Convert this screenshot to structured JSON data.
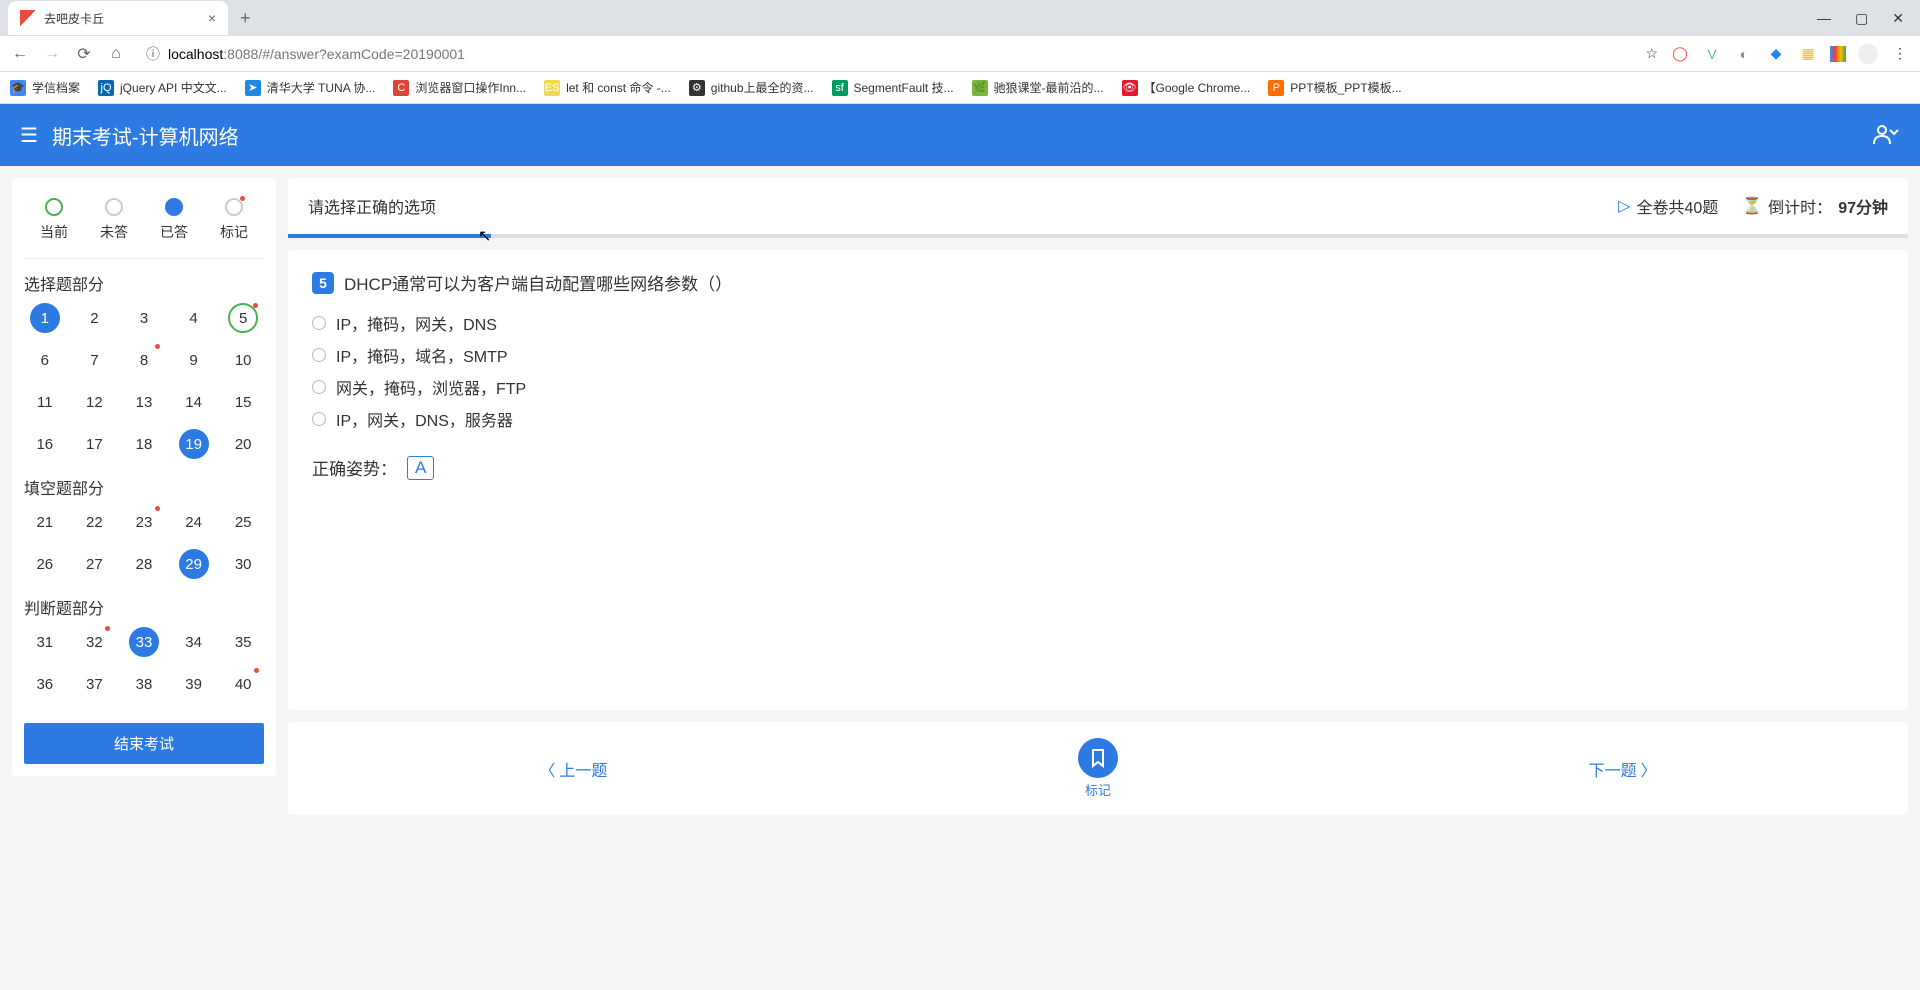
{
  "browser": {
    "tab_title": "去吧皮卡丘",
    "url_protocol": "localhost",
    "url_port": ":8088",
    "url_path": "/#/answer?examCode=20190001"
  },
  "bookmarks": [
    {
      "label": "学信档案",
      "icon": "🎓",
      "color": "#4285f4"
    },
    {
      "label": "jQuery API 中文文...",
      "icon": "jQ",
      "color": "#0769ad"
    },
    {
      "label": "清华大学 TUNA 协...",
      "icon": "➤",
      "color": "#1e88e5"
    },
    {
      "label": "浏览器窗口操作Inn...",
      "icon": "C",
      "color": "#db4437"
    },
    {
      "label": "let 和 const 命令 -...",
      "icon": "ES",
      "color": "#f0db4f"
    },
    {
      "label": "github上最全的资...",
      "icon": "⚙",
      "color": "#333"
    },
    {
      "label": "SegmentFault 技...",
      "icon": "sf",
      "color": "#009a61"
    },
    {
      "label": "驰狼课堂-最前沿的...",
      "icon": "🌿",
      "color": "#7cb342"
    },
    {
      "label": "【Google Chrome...",
      "icon": "👁",
      "color": "#e6162d"
    },
    {
      "label": "PPT模板_PPT模板...",
      "icon": "P",
      "color": "#ff6d00"
    }
  ],
  "header": {
    "title": "期末考试-计算机网络"
  },
  "legend": {
    "current": "当前",
    "unanswered": "未答",
    "answered": "已答",
    "marked": "标记"
  },
  "sections": [
    {
      "title": "选择题部分",
      "questions": [
        {
          "n": 1,
          "state": "answered"
        },
        {
          "n": 2,
          "state": ""
        },
        {
          "n": 3,
          "state": ""
        },
        {
          "n": 4,
          "state": ""
        },
        {
          "n": 5,
          "state": "current marked"
        },
        {
          "n": 6,
          "state": ""
        },
        {
          "n": 7,
          "state": ""
        },
        {
          "n": 8,
          "state": "marked"
        },
        {
          "n": 9,
          "state": ""
        },
        {
          "n": 10,
          "state": ""
        },
        {
          "n": 11,
          "state": ""
        },
        {
          "n": 12,
          "state": ""
        },
        {
          "n": 13,
          "state": ""
        },
        {
          "n": 14,
          "state": ""
        },
        {
          "n": 15,
          "state": ""
        },
        {
          "n": 16,
          "state": ""
        },
        {
          "n": 17,
          "state": ""
        },
        {
          "n": 18,
          "state": ""
        },
        {
          "n": 19,
          "state": "answered"
        },
        {
          "n": 20,
          "state": ""
        }
      ]
    },
    {
      "title": "填空题部分",
      "questions": [
        {
          "n": 21,
          "state": ""
        },
        {
          "n": 22,
          "state": ""
        },
        {
          "n": 23,
          "state": "marked"
        },
        {
          "n": 24,
          "state": ""
        },
        {
          "n": 25,
          "state": ""
        },
        {
          "n": 26,
          "state": ""
        },
        {
          "n": 27,
          "state": ""
        },
        {
          "n": 28,
          "state": ""
        },
        {
          "n": 29,
          "state": "answered"
        },
        {
          "n": 30,
          "state": ""
        }
      ]
    },
    {
      "title": "判断题部分",
      "questions": [
        {
          "n": 31,
          "state": ""
        },
        {
          "n": 32,
          "state": "marked"
        },
        {
          "n": 33,
          "state": "answered"
        },
        {
          "n": 34,
          "state": ""
        },
        {
          "n": 35,
          "state": ""
        },
        {
          "n": 36,
          "state": ""
        },
        {
          "n": 37,
          "state": ""
        },
        {
          "n": 38,
          "state": ""
        },
        {
          "n": 39,
          "state": ""
        },
        {
          "n": 40,
          "state": "marked"
        }
      ]
    }
  ],
  "end_exam": "结束考试",
  "content_top": {
    "instruction": "请选择正确的选项",
    "total": "全卷共40题",
    "countdown_label": "倒计时：",
    "countdown_value": "97分钟"
  },
  "question": {
    "number": "5",
    "text": "DHCP通常可以为客户端自动配置哪些网络参数（）",
    "options": [
      "IP，掩码，网关，DNS",
      "IP，掩码，域名，SMTP",
      "网关，掩码，浏览器，FTP",
      "IP，网关，DNS，服务器"
    ],
    "correct_label": "正确姿势：",
    "correct_answer": "A"
  },
  "footer": {
    "prev": "上一题",
    "mark": "标记",
    "next": "下一题"
  }
}
